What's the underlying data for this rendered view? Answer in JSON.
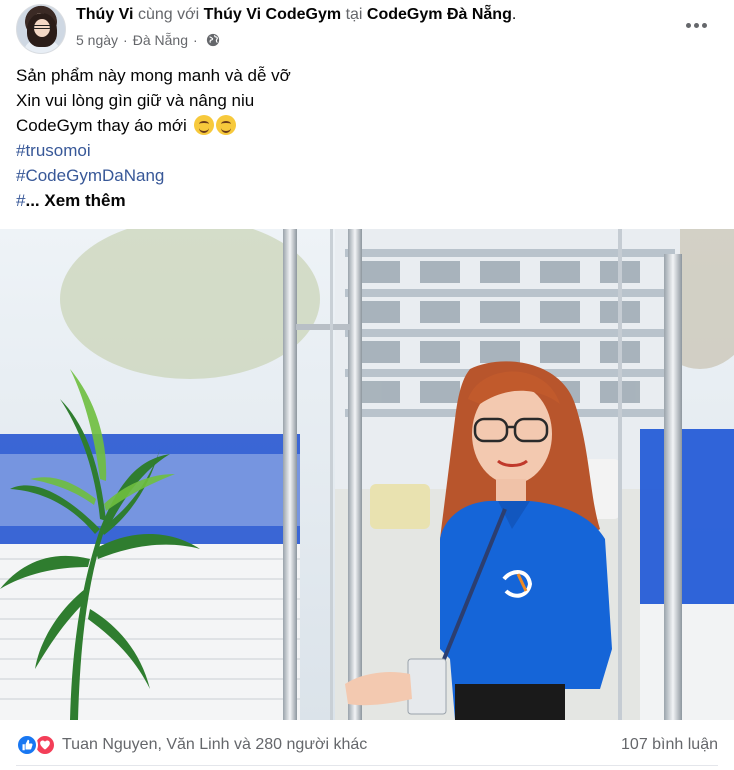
{
  "post": {
    "author": "Thúy Vi",
    "with_text": "cùng với",
    "tagged": "Thúy Vi CodeGym",
    "at_text": "tại",
    "location_page": "CodeGym Đà Nẵng",
    "end_punct": ".",
    "time": "5 ngày",
    "place": "Đà Nẵng",
    "separator": "·",
    "privacy_icon": "globe-icon"
  },
  "text": {
    "line1": "Sản phẩm này mong manh và dễ vỡ",
    "line2": "Xin vui lòng gìn giữ và nâng niu",
    "line3": "CodeGym thay áo mới",
    "line3_emoji": "smiling-face-emoji",
    "hashtag1": "#trusomoi",
    "hashtag2": "#CodeGymDaNang",
    "hashtag3_prefix": "#",
    "see_more": "... Xem thêm"
  },
  "photo": {
    "alt_icon": "photo-woman-in-blue-codegym-shirt"
  },
  "footer": {
    "reaction_icons": [
      "like-icon",
      "love-icon"
    ],
    "reaction_names": "Tuan Nguyen, Văn Linh và 280 người khác",
    "comments": "107 bình luận"
  },
  "colors": {
    "hashtag": "#385898",
    "meta": "#65676b",
    "like": "#1877f2",
    "love": "#f33e58",
    "shirt": "#1565d8"
  }
}
